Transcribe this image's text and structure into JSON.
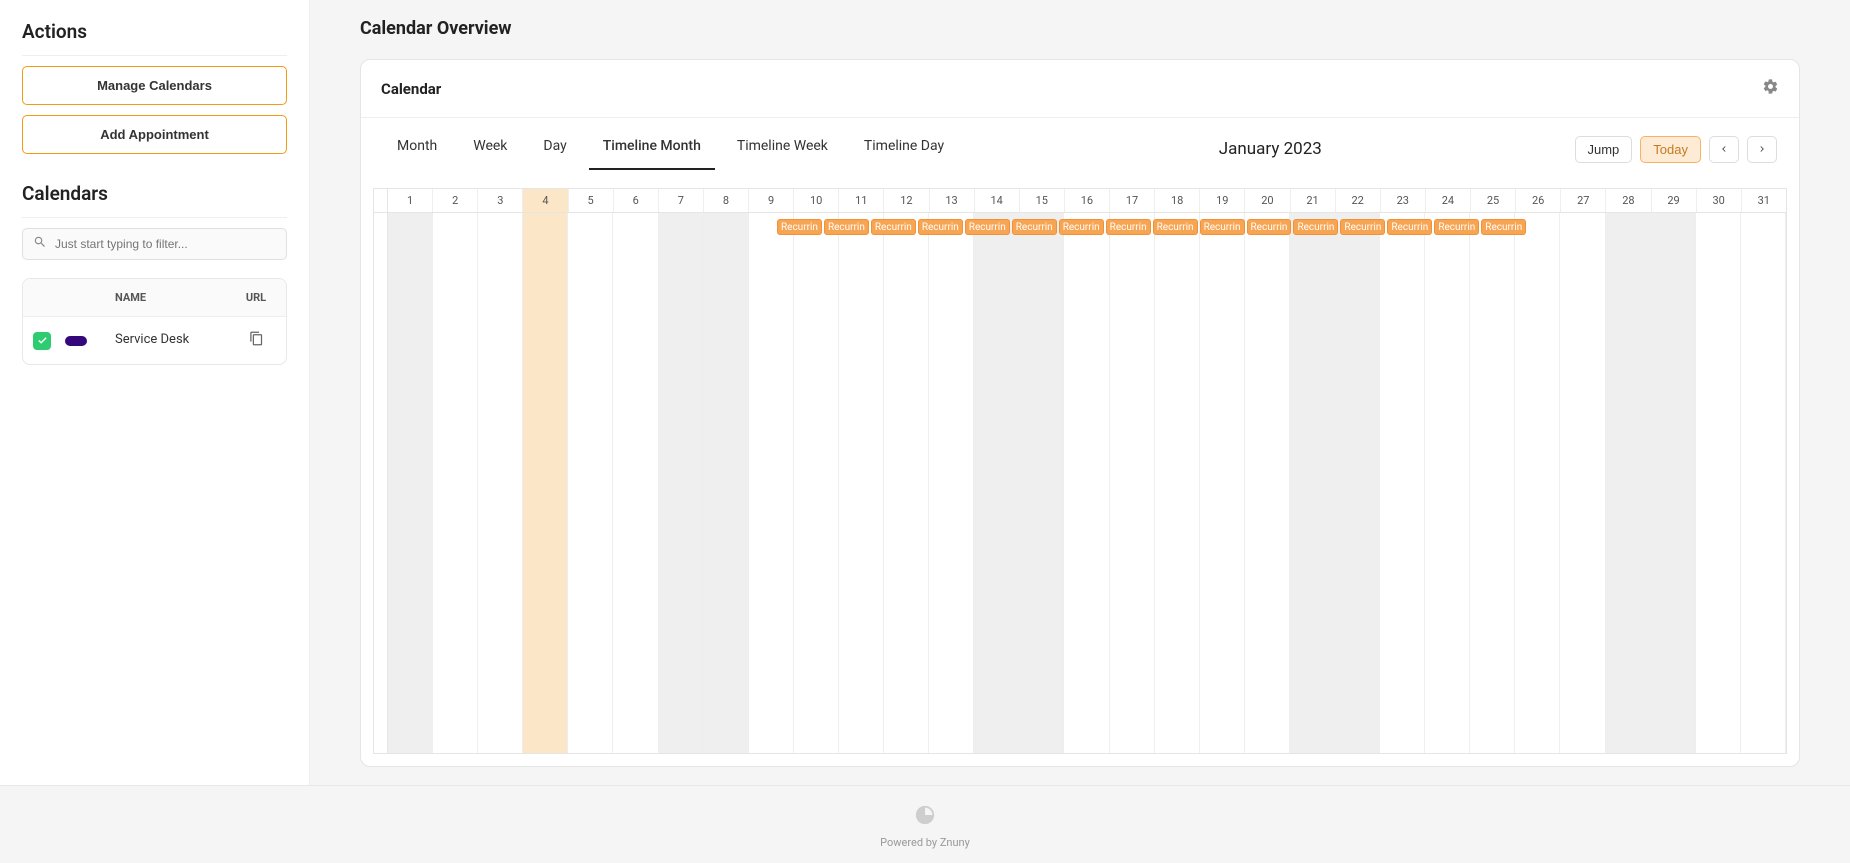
{
  "sidebar": {
    "actions_heading": "Actions",
    "manage_label": "Manage Calendars",
    "add_label": "Add Appointment",
    "calendars_heading": "Calendars",
    "filter_placeholder": "Just start typing to filter...",
    "table": {
      "name_header": "NAME",
      "url_header": "URL",
      "rows": [
        {
          "name": "Service Desk",
          "color": "#34077a",
          "checked": true
        }
      ]
    }
  },
  "page": {
    "title": "Calendar Overview",
    "card_title": "Calendar"
  },
  "calendar": {
    "views": [
      "Month",
      "Week",
      "Day",
      "Timeline Month",
      "Timeline Week",
      "Timeline Day"
    ],
    "active_view": "Timeline Month",
    "period_title": "January 2023",
    "jump_label": "Jump",
    "today_label": "Today",
    "today_index": 3,
    "days": [
      {
        "n": 1,
        "weekend": true
      },
      {
        "n": 2,
        "weekend": false
      },
      {
        "n": 3,
        "weekend": false
      },
      {
        "n": 4,
        "weekend": false
      },
      {
        "n": 5,
        "weekend": false
      },
      {
        "n": 6,
        "weekend": false
      },
      {
        "n": 7,
        "weekend": true
      },
      {
        "n": 8,
        "weekend": true
      },
      {
        "n": 9,
        "weekend": false
      },
      {
        "n": 10,
        "weekend": false
      },
      {
        "n": 11,
        "weekend": false
      },
      {
        "n": 12,
        "weekend": false
      },
      {
        "n": 13,
        "weekend": false
      },
      {
        "n": 14,
        "weekend": true
      },
      {
        "n": 15,
        "weekend": true
      },
      {
        "n": 16,
        "weekend": false
      },
      {
        "n": 17,
        "weekend": false
      },
      {
        "n": 18,
        "weekend": false
      },
      {
        "n": 19,
        "weekend": false
      },
      {
        "n": 20,
        "weekend": false
      },
      {
        "n": 21,
        "weekend": true
      },
      {
        "n": 22,
        "weekend": true
      },
      {
        "n": 23,
        "weekend": false
      },
      {
        "n": 24,
        "weekend": false
      },
      {
        "n": 25,
        "weekend": false
      },
      {
        "n": 26,
        "weekend": false
      },
      {
        "n": 27,
        "weekend": false
      },
      {
        "n": 28,
        "weekend": true
      },
      {
        "n": 29,
        "weekend": true
      },
      {
        "n": 30,
        "weekend": false
      },
      {
        "n": 31,
        "weekend": false
      }
    ],
    "events": [
      {
        "day": 10,
        "label": "Recurrin"
      },
      {
        "day": 11,
        "label": "Recurrin"
      },
      {
        "day": 12,
        "label": "Recurrin"
      },
      {
        "day": 13,
        "label": "Recurrin"
      },
      {
        "day": 14,
        "label": "Recurrin"
      },
      {
        "day": 15,
        "label": "Recurrin"
      },
      {
        "day": 16,
        "label": "Recurrin"
      },
      {
        "day": 17,
        "label": "Recurrin"
      },
      {
        "day": 18,
        "label": "Recurrin"
      },
      {
        "day": 19,
        "label": "Recurrin"
      },
      {
        "day": 20,
        "label": "Recurrin"
      },
      {
        "day": 21,
        "label": "Recurrin"
      },
      {
        "day": 22,
        "label": "Recurrin"
      },
      {
        "day": 23,
        "label": "Recurrin"
      },
      {
        "day": 24,
        "label": "Recurrin"
      },
      {
        "day": 25,
        "label": "Recurrin"
      }
    ]
  },
  "footer": {
    "line": "Powered by Znuny"
  }
}
